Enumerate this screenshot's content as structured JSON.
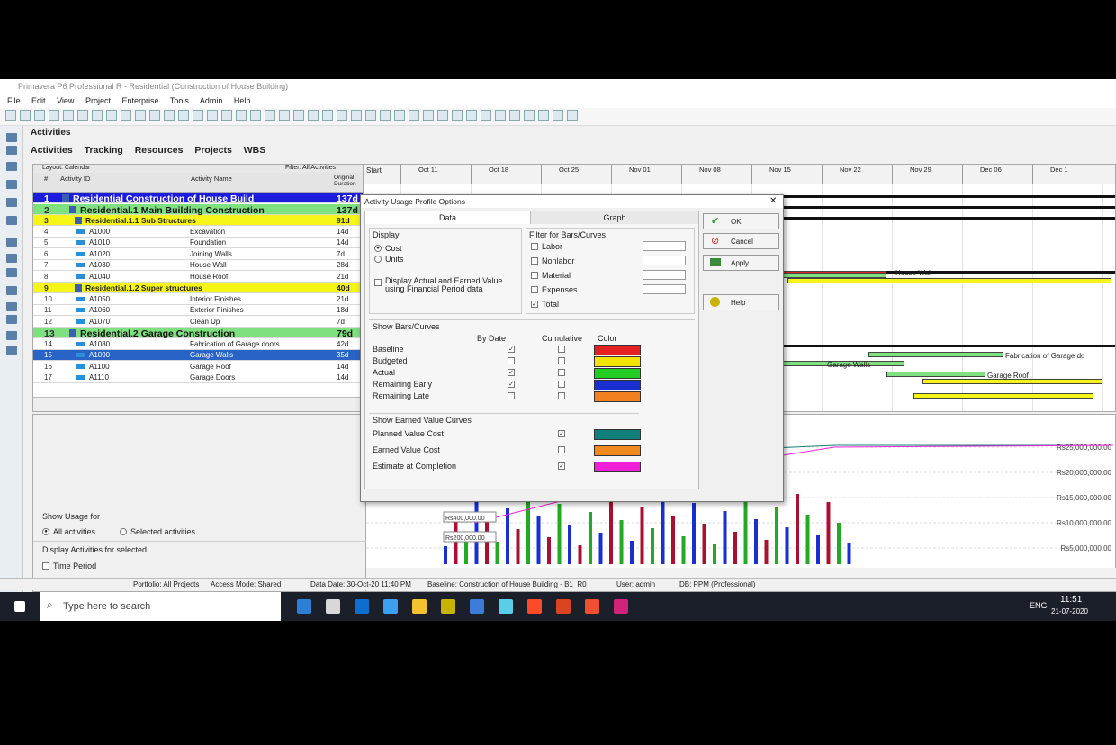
{
  "window": {
    "title": "Primavera P6 Professional R - Residential (Construction of House Building)"
  },
  "menu": [
    "File",
    "Edit",
    "View",
    "Project",
    "Enterprise",
    "Tools",
    "Admin",
    "Help"
  ],
  "pane": {
    "title": "Activities"
  },
  "tabs": [
    "Activities",
    "Tracking",
    "Resources",
    "Projects",
    "WBS"
  ],
  "grid": {
    "layout": "Layout: Calendar",
    "filter": "Filter: All Activities",
    "columns": {
      "num": "#",
      "id": "Activity ID",
      "name": "Activity Name",
      "dur": "Original Duration",
      "start": "Start"
    },
    "rows": [
      {
        "n": "1",
        "id": "Residential  Construction of House Build",
        "name": "",
        "dur": "137d",
        "kind": "proj"
      },
      {
        "n": "2",
        "id": "Residential.1  Main Building Construction",
        "name": "",
        "dur": "137d",
        "kind": "wbs1"
      },
      {
        "n": "3",
        "id": "Residential.1.1  Sub Structures",
        "name": "",
        "dur": "91d",
        "kind": "wbs2"
      },
      {
        "n": "4",
        "id": "A1000",
        "name": "Excavation",
        "dur": "14d",
        "kind": "act"
      },
      {
        "n": "5",
        "id": "A1010",
        "name": "Foundation",
        "dur": "14d",
        "kind": "act"
      },
      {
        "n": "6",
        "id": "A1020",
        "name": "Joining Walls",
        "dur": "7d",
        "kind": "act"
      },
      {
        "n": "7",
        "id": "A1030",
        "name": "House Wall",
        "dur": "28d",
        "kind": "act"
      },
      {
        "n": "8",
        "id": "A1040",
        "name": "House Roof",
        "dur": "21d",
        "kind": "act"
      },
      {
        "n": "9",
        "id": "Residential.1.2  Super structures",
        "name": "",
        "dur": "40d",
        "kind": "wbs2"
      },
      {
        "n": "10",
        "id": "A1050",
        "name": "Interior Finishes",
        "dur": "21d",
        "kind": "act"
      },
      {
        "n": "11",
        "id": "A1060",
        "name": "Exterior Finishes",
        "dur": "18d",
        "kind": "act"
      },
      {
        "n": "12",
        "id": "A1070",
        "name": "Clean Up",
        "dur": "7d",
        "kind": "act"
      },
      {
        "n": "13",
        "id": "Residential.2  Garage Construction",
        "name": "",
        "dur": "79d",
        "kind": "wbs1"
      },
      {
        "n": "14",
        "id": "A1080",
        "name": "Fabrication of Garage doors",
        "dur": "42d",
        "kind": "act"
      },
      {
        "n": "15",
        "id": "A1090",
        "name": "Garage Walls",
        "dur": "35d",
        "kind": "sel"
      },
      {
        "n": "16",
        "id": "A1100",
        "name": "Garage Roof",
        "dur": "14d",
        "kind": "act"
      },
      {
        "n": "17",
        "id": "A1110",
        "name": "Garage Doors",
        "dur": "14d",
        "kind": "act"
      }
    ]
  },
  "gantt": {
    "months": [
      "Oct 11",
      "Oct 18",
      "Oct 25",
      "Nov 01",
      "Nov 08",
      "Nov 15",
      "Nov 22",
      "Nov 29",
      "Dec 06",
      "Dec 1"
    ],
    "labels": {
      "house_wall": "House Wall",
      "fab": "Fabrication of Garage do",
      "garage_walls": "Garage Walls",
      "garage_roof": "Garage Roof"
    }
  },
  "dialog": {
    "title": "Activity Usage Profile Options",
    "tab_data": "Data",
    "tab_graph": "Graph",
    "display": {
      "label": "Display",
      "cost": "Cost",
      "units": "Units",
      "earned": "Display Actual and Earned Value using Financial Period data"
    },
    "filter": {
      "label": "Filter for Bars/Curves",
      "items": [
        "Labor",
        "Nonlabor",
        "Material",
        "Expenses",
        "Total"
      ]
    },
    "bars": {
      "label": "Show Bars/Curves",
      "by_date": "By Date",
      "cumulative": "Cumulative",
      "color": "Color",
      "items": [
        {
          "name": "Baseline",
          "color": "#e52020",
          "bydate": true,
          "cum": false
        },
        {
          "name": "Budgeted",
          "color": "#f2e400",
          "bydate": false,
          "cum": false
        },
        {
          "name": "Actual",
          "color": "#22cc22",
          "bydate": true,
          "cum": false
        },
        {
          "name": "Remaining Early",
          "color": "#1a2fd0",
          "bydate": true,
          "cum": false
        },
        {
          "name": "Remaining Late",
          "color": "#f08020",
          "bydate": false,
          "cum": false
        }
      ]
    },
    "ev": {
      "label": "Show Earned Value Curves",
      "items": [
        {
          "name": "Planned Value Cost",
          "color": "#12807a",
          "checked": true
        },
        {
          "name": "Earned Value Cost",
          "color": "#f08a1e",
          "checked": false
        },
        {
          "name": "Estimate at Completion",
          "color": "#f020d8",
          "checked": true
        }
      ]
    },
    "buttons": {
      "ok": "OK",
      "cancel": "Cancel",
      "apply": "Apply",
      "help": "Help"
    }
  },
  "usage": {
    "show_for": "Show Usage for",
    "all": "All activities",
    "selected": "Selected activities",
    "display_for": "Display Activities for selected...",
    "time_period": "Time Period",
    "axis": [
      "Rs25,000,000.00",
      "Rs20,000,000.00",
      "Rs15,000,000.00",
      "Rs10,000,000.00",
      "Rs5,000,000.00"
    ],
    "bar_labels": [
      "Rs400,000.00",
      "Rs200,000.00"
    ]
  },
  "status": {
    "portfolio": "Portfolio: All Projects",
    "access": "Access Mode: Shared",
    "data_date": "Data Date: 30-Oct-20 11:40 PM",
    "baseline": "Baseline: Construction of House Building - B1_R0",
    "user": "User: admin",
    "db": "DB: PPM (Professional)"
  },
  "taskbar": {
    "search": "Type here to search",
    "time": "11:51",
    "date": "21-07-2020",
    "lang": "ENG"
  }
}
